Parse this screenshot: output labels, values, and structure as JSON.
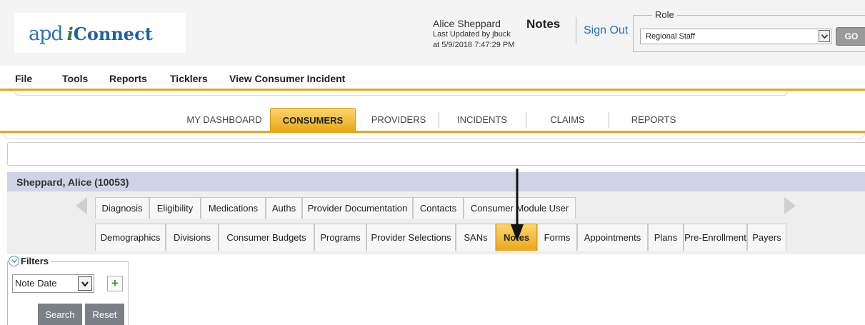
{
  "header": {
    "logo": {
      "prefix": "apd",
      "i": "i",
      "rest": "Connect"
    },
    "user": {
      "name": "Alice Sheppard",
      "updated_by": "Last Updated by jbuck",
      "updated_at": "at 5/9/2018 7:47:29 PM"
    },
    "page_title": "Notes",
    "sign_out": "Sign Out",
    "role": {
      "legend": "Role",
      "selected": "Regional Staff",
      "go": "GO"
    }
  },
  "menu": [
    "File",
    "Tools",
    "Reports",
    "Ticklers",
    "View Consumer Incident"
  ],
  "main_tabs": [
    "MY DASHBOARD",
    "CONSUMERS",
    "PROVIDERS",
    "INCIDENTS",
    "CLAIMS",
    "REPORTS"
  ],
  "main_tab_active": "CONSUMERS",
  "consumer": {
    "title": "Sheppard, Alice (10053)"
  },
  "sub_tabs_row1": [
    "Diagnosis",
    "Eligibility",
    "Medications",
    "Auths",
    "Provider Documentation",
    "Contacts",
    "Consumer Module User"
  ],
  "sub_tabs_row2": [
    "Demographics",
    "Divisions",
    "Consumer Budgets",
    "Programs",
    "Provider Selections",
    "SANs",
    "Notes",
    "Forms",
    "Appointments",
    "Plans",
    "Pre-Enrollment",
    "Payers"
  ],
  "sub_tab_active": "Notes",
  "filters": {
    "legend": "Filters",
    "field": "Note Date",
    "add_icon": "plus-icon",
    "search": "Search",
    "reset": "Reset"
  },
  "colors": {
    "accent": "#e3a81a",
    "consumer_bar": "#cfd3e5",
    "link": "#2a6eb0"
  }
}
